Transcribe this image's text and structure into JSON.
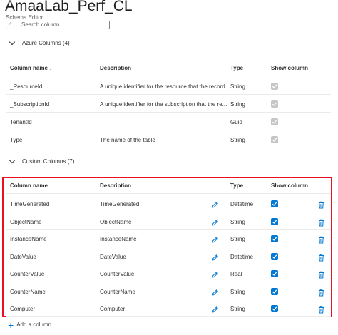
{
  "header": {
    "title": "AmaaLab_Perf_CL",
    "subtitle": "Schema Editor"
  },
  "search": {
    "placeholder": "Search column"
  },
  "azure": {
    "section_label": "Azure Columns (4)",
    "headers": {
      "name": "Column name ↓",
      "description": "Description",
      "type": "Type",
      "show": "Show column"
    },
    "rows": [
      {
        "name": "_ResourceId",
        "description": "A unique identifier for the resource that the record...",
        "type": "String",
        "show": true
      },
      {
        "name": "_SubscriptionId",
        "description": "A unique identifier for the subscription that the re...",
        "type": "String",
        "show": true
      },
      {
        "name": "TenantId",
        "description": "",
        "type": "Guid",
        "show": true
      },
      {
        "name": "Type",
        "description": "The name of the table",
        "type": "String",
        "show": true
      }
    ]
  },
  "custom": {
    "section_label": "Custom Columns (7)",
    "headers": {
      "name": "Column name ↑",
      "description": "Description",
      "type": "Type",
      "show": "Show column"
    },
    "rows": [
      {
        "name": "TimeGenerated",
        "description": "TimeGenerated",
        "type": "Datetime",
        "show": true
      },
      {
        "name": "ObjectName",
        "description": "ObjectName",
        "type": "String",
        "show": true
      },
      {
        "name": "InstanceName",
        "description": "InstanceName",
        "type": "String",
        "show": true
      },
      {
        "name": "DateValue",
        "description": "DateValue",
        "type": "Datetime",
        "show": true
      },
      {
        "name": "CounterValue",
        "description": "CounterValue",
        "type": "Real",
        "show": true
      },
      {
        "name": "CounterName",
        "description": "CounterName",
        "type": "String",
        "show": true
      },
      {
        "name": "Computer",
        "description": "Computer",
        "type": "String",
        "show": true
      }
    ]
  },
  "footer": {
    "add_label": "Add a column"
  },
  "colors": {
    "accent": "#0078d4",
    "highlight": "#e81123",
    "disabled_check": "#c8c6c4"
  }
}
